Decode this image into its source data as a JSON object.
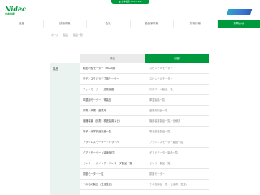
{
  "header": {
    "top_tab": "■ 日本電産 Global Site",
    "logo_main": "Nidec",
    "logo_sub": "日本電産"
  },
  "nav": [
    "製品",
    "技術情報",
    "会社",
    "投資家情報",
    "採用情報",
    "お問合せ"
  ],
  "breadcrumb": [
    "ホーム",
    "製品",
    "製品一覧"
  ],
  "columns": [
    "項目",
    "内容"
  ],
  "side_label": "製品",
  "rows": [
    {
      "label": "精密小型モーター（HDD用）",
      "value": "スピンドルモーター"
    },
    {
      "label": "光ディスクドライブ用モーター",
      "value": "スピンドルモーター"
    },
    {
      "label": "ファンモーター・送風機器",
      "value": "冷却ファン製品一覧"
    },
    {
      "label": "車載用モーター・電装品",
      "value": "車載製品一覧"
    },
    {
      "label": "家電・商業・産業用",
      "value": "産業用製品一覧"
    },
    {
      "label": "機器装置（計測・検査装置など）",
      "value": "機器装置製品一覧・仕様書"
    },
    {
      "label": "電子・光学部品製品一覧",
      "value": "電子部品製品一覧"
    },
    {
      "label": "ブラシレスモーター・ドライバ",
      "value": "ブラシレスモーター製品一覧"
    },
    {
      "label": "ギアドモーター（減速機付）",
      "value": "ギアドモーター製品一覧"
    },
    {
      "label": "センサー・スイッチ・エンコーダ製品一覧",
      "value": "センサー製品一覧"
    },
    {
      "label": "振動モーター一覧",
      "value": "振動モーター"
    },
    {
      "label": "その他の製品（受注生産）",
      "value": "その他製品一覧・仕様書（受注）"
    }
  ]
}
